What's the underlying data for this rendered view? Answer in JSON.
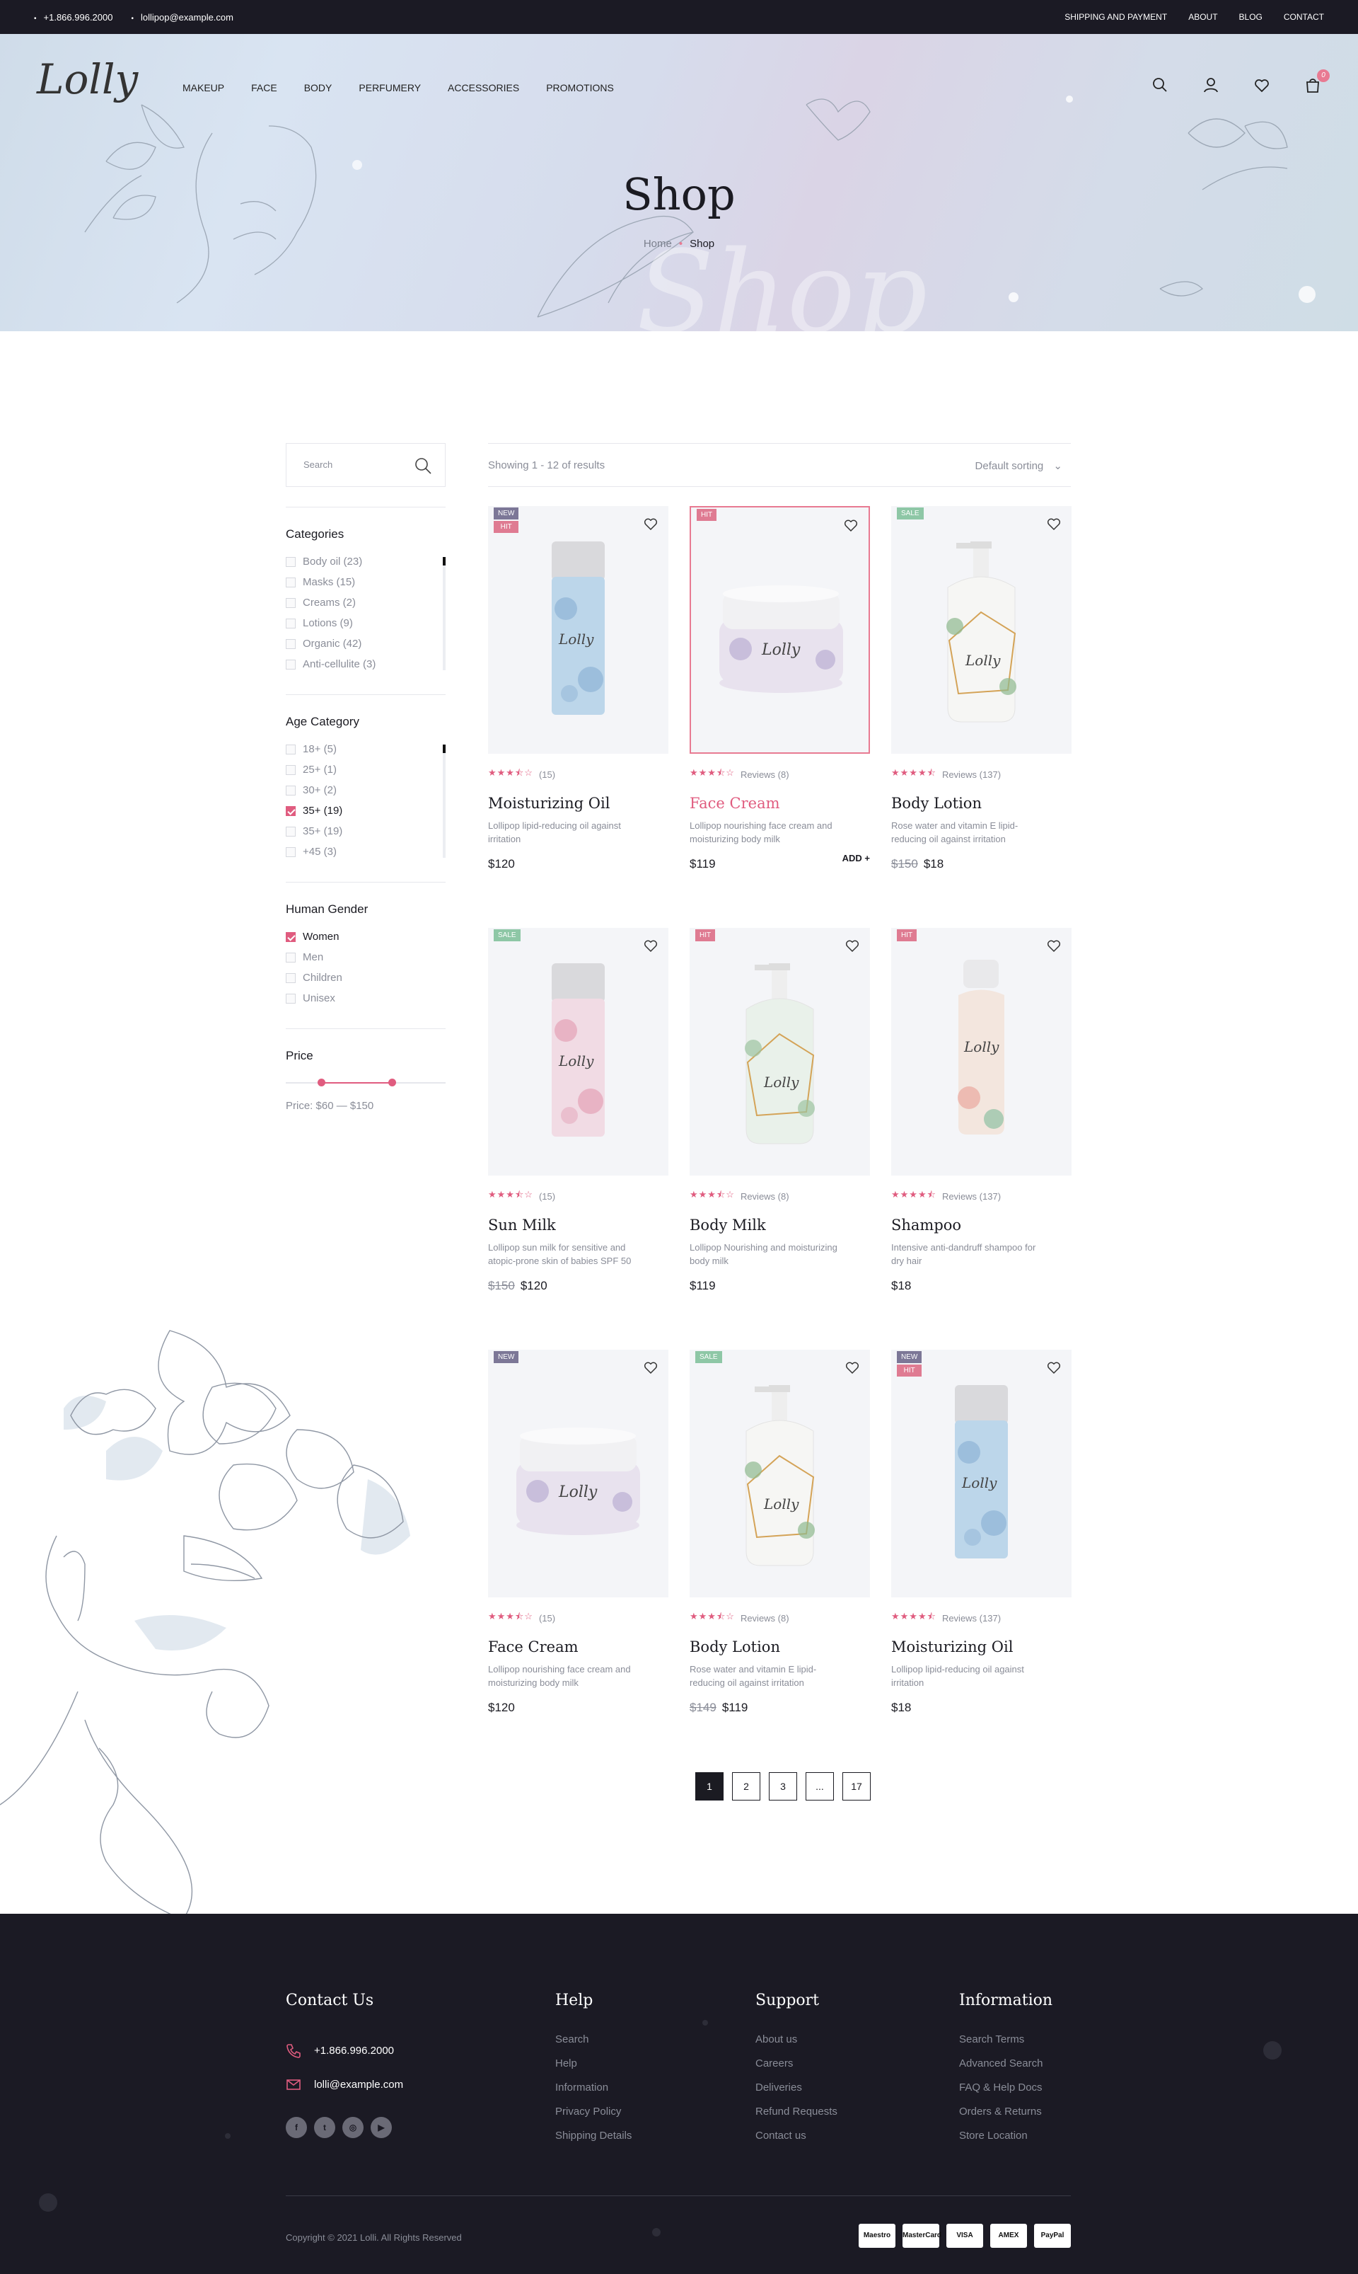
{
  "topbar": {
    "phone": "+1.866.996.2000",
    "email": "lollipop@example.com",
    "links": [
      "SHIPPING AND PAYMENT",
      "ABOUT",
      "BLOG",
      "CONTACT"
    ]
  },
  "header": {
    "logo": "Lolly",
    "nav": [
      "MAKEUP",
      "FACE",
      "BODY",
      "PERFUMERY",
      "ACCESSORIES",
      "PROMOTIONS"
    ],
    "cart_count": "0"
  },
  "hero": {
    "title": "Shop",
    "breadcrumb": [
      "Home",
      "Shop"
    ],
    "watermark": "Shop"
  },
  "sidebar": {
    "search_placeholder": "Search",
    "categories": {
      "title": "Categories",
      "items": [
        "Body oil (23)",
        "Masks (15)",
        "Creams (2)",
        "Lotions (9)",
        "Organic (42)",
        "Anti-cellulite (3)"
      ]
    },
    "age": {
      "title": "Age Category",
      "items": [
        "18+ (5)",
        "25+ (1)",
        "30+ (2)",
        "35+ (19)",
        "35+ (19)",
        "+45 (3)"
      ],
      "checked_index": 3
    },
    "gender": {
      "title": "Human Gender",
      "items": [
        "Women",
        "Men",
        "Children",
        "Unisex"
      ],
      "checked_index": 0
    },
    "price": {
      "title": "Price",
      "label": "Price: $60 — $150",
      "min": 60,
      "max": 150
    }
  },
  "toolbar": {
    "results": "Showing 1 - 12 of results",
    "sorting": "Default sorting"
  },
  "products": [
    {
      "tags": [
        "NEW",
        "HIT"
      ],
      "rating": 3.5,
      "reviews": "(15)",
      "name": "Moisturizing Oil",
      "desc": "Lollipop lipid-reducing oil against irritation",
      "old": "",
      "price": "$120",
      "kind": "spray",
      "colors": [
        "#bcd6ea",
        "#8fb3d6"
      ]
    },
    {
      "tags": [
        "HIT"
      ],
      "rating": 3.5,
      "reviews": "Reviews (8)",
      "name": "Face Cream",
      "desc": "Lollipop nourishing face cream and moisturizing body milk",
      "old": "",
      "price": "$119",
      "kind": "jar",
      "colors": [
        "#e8e2ee",
        "#b3a6cf"
      ],
      "selected": true,
      "add": "ADD"
    },
    {
      "tags": [
        "SALE"
      ],
      "rating": 4.5,
      "reviews": "Reviews (137)",
      "name": "Body Lotion",
      "desc": "Rose water and vitamin E lipid-reducing oil against irritation",
      "old": "$150",
      "price": "$18",
      "kind": "pump",
      "colors": [
        "#f6f6f4",
        "#8fb98f"
      ]
    },
    {
      "tags": [
        "SALE"
      ],
      "rating": 3.5,
      "reviews": "(15)",
      "name": "Sun Milk",
      "desc": "Lollipop sun milk for sensitive and atopic-prone skin of babies SPF 50",
      "old": "$150",
      "price": "$120",
      "kind": "spray",
      "colors": [
        "#f1dbe4",
        "#e4a3b7"
      ]
    },
    {
      "tags": [
        "HIT"
      ],
      "rating": 3.5,
      "reviews": "Reviews (8)",
      "name": "Body Milk",
      "desc": "Lollipop Nourishing and moisturizing body milk",
      "old": "",
      "price": "$119",
      "kind": "pump",
      "colors": [
        "#e9f1ea",
        "#9cc3a1"
      ]
    },
    {
      "tags": [
        "HIT"
      ],
      "rating": 4.5,
      "reviews": "Reviews (137)",
      "name": "Shampoo",
      "desc": "Intensive anti-dandruff shampoo for dry hair",
      "old": "",
      "price": "$18",
      "kind": "bottle",
      "colors": [
        "#f3e6de",
        "#e9a8a0"
      ]
    },
    {
      "tags": [
        "NEW"
      ],
      "rating": 3.5,
      "reviews": "(15)",
      "name": "Face Cream",
      "desc": "Lollipop nourishing face cream and moisturizing body milk",
      "old": "",
      "price": "$120",
      "kind": "jar",
      "colors": [
        "#e8e2ee",
        "#b3a6cf"
      ]
    },
    {
      "tags": [
        "SALE"
      ],
      "rating": 3.5,
      "reviews": "Reviews (8)",
      "name": "Body Lotion",
      "desc": "Rose water and vitamin E lipid-reducing oil against irritation",
      "old": "$149",
      "price": "$119",
      "kind": "pump",
      "colors": [
        "#f6f6f4",
        "#8fb98f"
      ]
    },
    {
      "tags": [
        "NEW",
        "HIT"
      ],
      "rating": 4.5,
      "reviews": "Reviews (137)",
      "name": "Moisturizing Oil",
      "desc": "Lollipop lipid-reducing oil against irritation",
      "old": "",
      "price": "$18",
      "kind": "spray",
      "colors": [
        "#bcd6ea",
        "#8fb3d6"
      ]
    }
  ],
  "pagination": [
    "1",
    "2",
    "3",
    "...",
    "17"
  ],
  "footer": {
    "contact": {
      "title": "Contact Us",
      "phone": "+1.866.996.2000",
      "email": "lolli@example.com"
    },
    "help": {
      "title": "Help",
      "links": [
        "Search",
        "Help",
        "Information",
        "Privacy Policy",
        "Shipping Details"
      ]
    },
    "support": {
      "title": "Support",
      "links": [
        "About us",
        "Careers",
        "Deliveries",
        "Refund Requests",
        "Contact us"
      ]
    },
    "info": {
      "title": "Information",
      "links": [
        "Search Terms",
        "Advanced Search",
        "FAQ & Help Docs",
        "Orders & Returns",
        "Store Location"
      ]
    },
    "copyright": "Copyright © 2021 Lolli.  All Rights Reserved",
    "payments": [
      "Maestro",
      "MasterCard",
      "VISA",
      "AMEX",
      "PayPal"
    ]
  },
  "colors": {
    "accent": "#e05c7f",
    "dark": "#1b1a24",
    "tag_new": "#7c7797",
    "tag_hit": "#df7b92",
    "tag_sale": "#8ec7a6"
  }
}
